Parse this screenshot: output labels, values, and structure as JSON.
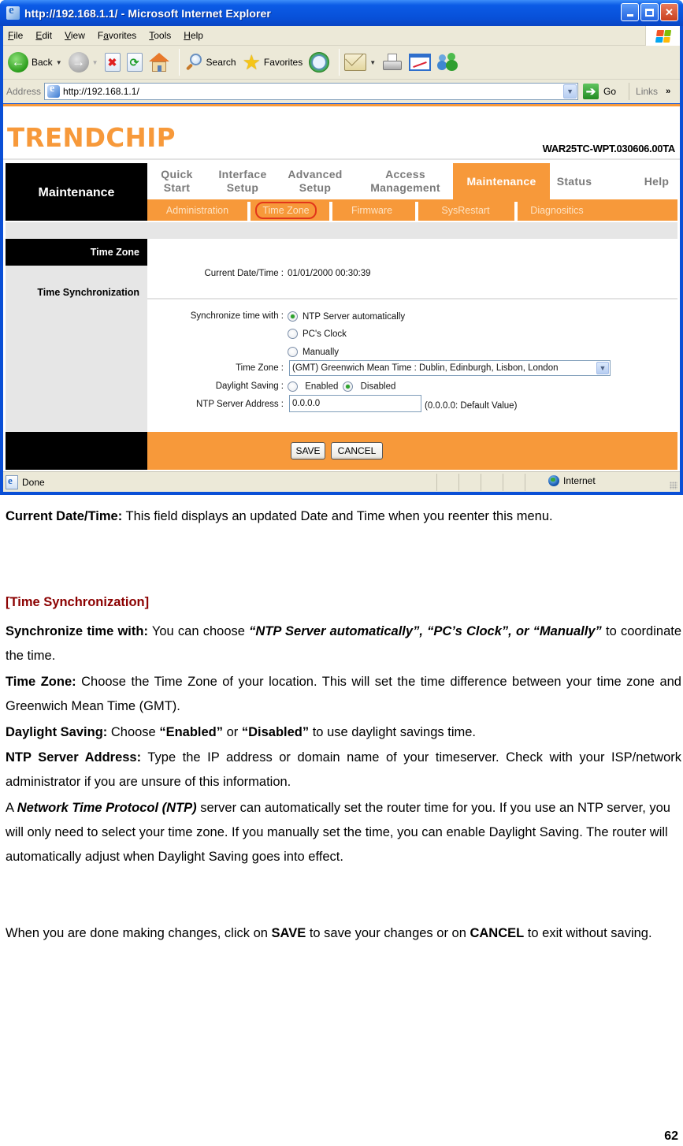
{
  "browser": {
    "title": "http://192.168.1.1/ - Microsoft Internet Explorer",
    "menu": [
      "File",
      "Edit",
      "View",
      "Favorites",
      "Tools",
      "Help"
    ],
    "menu_underline": [
      "F",
      "E",
      "V",
      "a",
      "T",
      "H"
    ],
    "toolbar": {
      "back_label": "Back",
      "search_label": "Search",
      "favorites_label": "Favorites"
    },
    "address_label": "Address",
    "address_value": "http://192.168.1.1/",
    "go_label": "Go",
    "links_label": "Links",
    "status_text": "Done",
    "zone_text": "Internet"
  },
  "router": {
    "brand": "TRENDCHIP",
    "model": "WAR25TC-WPT.030606.00TA",
    "section_title": "Maintenance",
    "main_tabs": [
      {
        "label": "Quick\nStart",
        "active": false
      },
      {
        "label": "Interface\nSetup",
        "active": false
      },
      {
        "label": "Advanced\nSetup",
        "active": false
      },
      {
        "label": "Access\nManagement",
        "active": false
      },
      {
        "label": "Maintenance",
        "active": true
      },
      {
        "label": "Status",
        "active": false
      },
      {
        "label": "Help",
        "active": false
      }
    ],
    "sub_tabs": [
      {
        "label": "Administration",
        "current": false
      },
      {
        "label": "Time Zone",
        "current": true
      },
      {
        "label": "Firmware",
        "current": false
      },
      {
        "label": "SysRestart",
        "current": false
      },
      {
        "label": "Diagnositics",
        "current": false
      }
    ],
    "side_header": "Time Zone",
    "side_section": "Time Synchronization",
    "form": {
      "current_datetime_label": "Current Date/Time :",
      "current_datetime_value": "01/01/2000 00:30:39",
      "sync_label": "Synchronize time with :",
      "sync_options": [
        {
          "label": "NTP Server automatically",
          "checked": true
        },
        {
          "label": "PC's Clock",
          "checked": false
        },
        {
          "label": "Manually",
          "checked": false
        }
      ],
      "timezone_label": "Time Zone :",
      "timezone_value": "(GMT) Greenwich Mean Time : Dublin, Edinburgh, Lisbon, London",
      "daylight_label": "Daylight Saving :",
      "daylight_options": [
        {
          "label": "Enabled",
          "checked": false
        },
        {
          "label": "Disabled",
          "checked": true
        }
      ],
      "ntp_label": "NTP Server Address :",
      "ntp_value": "0.0.0.0",
      "ntp_hint": "(0.0.0.0: Default Value)"
    },
    "buttons": {
      "save": "SAVE",
      "cancel": "CANCEL"
    }
  },
  "document": {
    "p1_bold": "Current Date/Time:",
    "p1_text": " This field displays an updated Date and Time when you reenter this menu.",
    "heading": "[Time Synchronization]",
    "p2_bold": "Synchronize time with:",
    "p2_text_a": " You can choose ",
    "p2_emph": "“NTP Server automatically”, “PC’s Clock”, or “Manually”",
    "p2_text_b": " to coordinate the time.",
    "p3_bold": "Time Zone:",
    "p3_text": " Choose the Time Zone of your location. This will set the time difference between your time zone and Greenwich Mean Time (GMT).",
    "p4_bold": "Daylight Saving:",
    "p4_text_a": " Choose ",
    "p4_emph_a": "“Enabled”",
    "p4_text_b": " or ",
    "p4_emph_b": "“Disabled”",
    "p4_text_c": " to use daylight savings time.",
    "p5_bold": "NTP Server Address:",
    "p5_text": " Type the IP address or domain name of your timeserver. Check with your ISP/network administrator if you are unsure of this information.",
    "p6_text_a": "A ",
    "p6_emph": "Network Time Protocol (NTP)",
    "p6_text_b": " server can automatically set the router time for you. If you use an NTP server, you will only need to select your time zone. If you manually set the time, you can enable Daylight Saving. The router will automatically adjust when Daylight Saving goes into effect.",
    "p7_text_a": "When you are done making changes, click on ",
    "p7_save": "SAVE",
    "p7_text_b": " to save your changes or on ",
    "p7_cancel": "CANCEL",
    "p7_text_c": " to exit without saving.",
    "page_number": "62"
  }
}
